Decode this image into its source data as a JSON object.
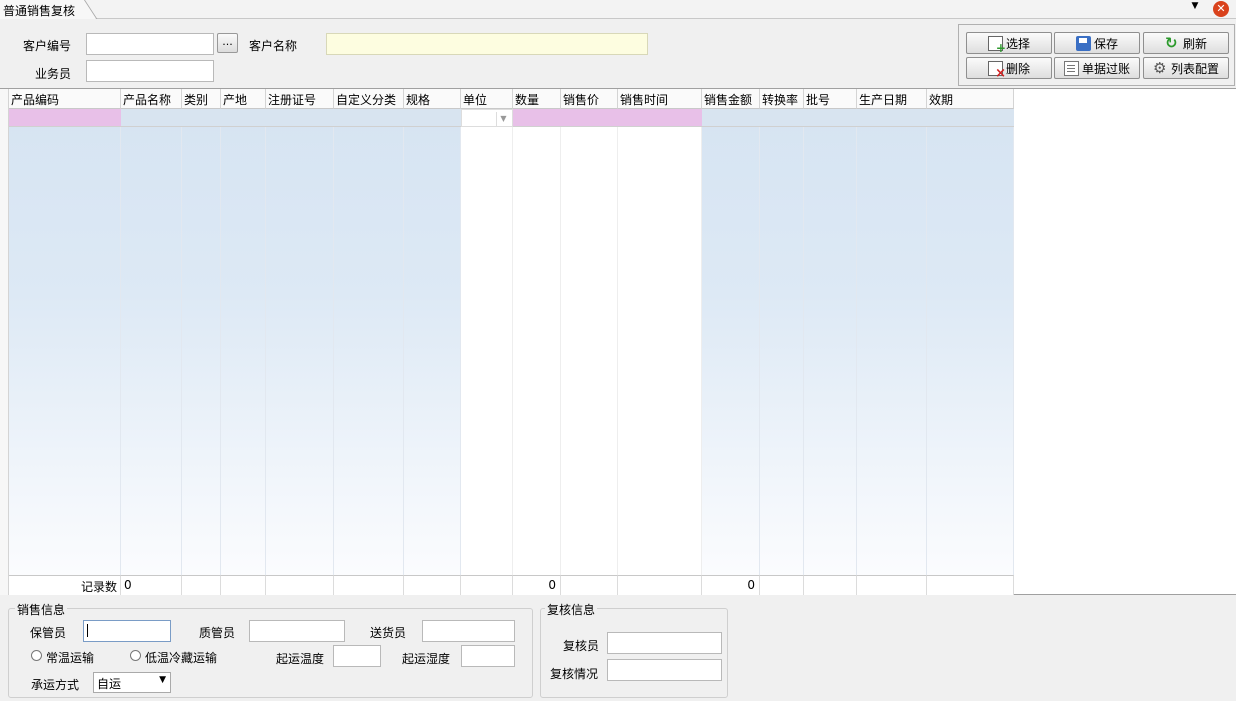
{
  "tab": {
    "title": "普通销售复核",
    "dropdown_icon": "▼",
    "close_icon": "✕"
  },
  "form": {
    "customer_code_label": "客户编号",
    "customer_code_value": "",
    "ellipsis": "...",
    "customer_name_label": "客户名称",
    "customer_name_value": "",
    "salesperson_label": "业务员",
    "salesperson_value": ""
  },
  "toolbar": {
    "select": "选择",
    "save": "保存",
    "refresh": "刷新",
    "delete": "删除",
    "post": "单据过账",
    "list_config": "列表配置"
  },
  "grid": {
    "columns": [
      "产品编码",
      "产品名称",
      "类别",
      "产地",
      "注册证号",
      "自定义分类",
      "规格",
      "单位",
      "数量",
      "销售价",
      "销售时间",
      "销售金额",
      "转换率",
      "批号",
      "生产日期",
      "效期"
    ],
    "footer": {
      "record_count_label": "记录数",
      "record_count": "0",
      "quantity_total": "0",
      "amount_total": "0"
    }
  },
  "sales_info": {
    "title": "销售信息",
    "keeper_label": "保管员",
    "quality_label": "质管员",
    "delivery_label": "送货员",
    "normal_temp_label": "常温运输",
    "cold_chain_label": "低温冷藏运输",
    "start_temp_label": "起运温度",
    "start_humidity_label": "起运湿度",
    "carrier_label": "承运方式",
    "carrier_value": "自运"
  },
  "review_info": {
    "title": "复核信息",
    "reviewer_label": "复核员",
    "review_status_label": "复核情况"
  },
  "colors": {
    "close": "#d9421c",
    "grid_blue": "#d6e4f2",
    "row_pink": "#e8c0e8",
    "name_field": "#fdfde0"
  }
}
